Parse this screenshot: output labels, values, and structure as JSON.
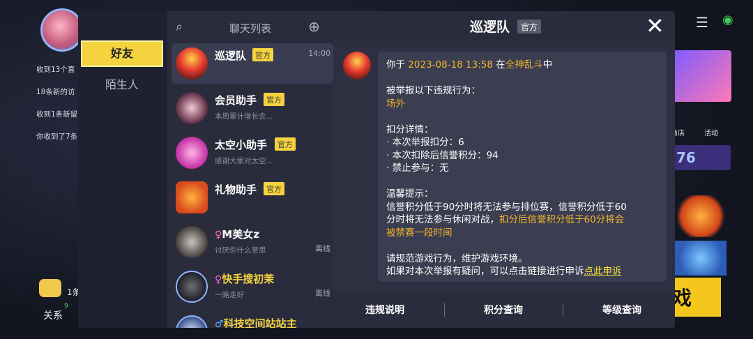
{
  "background": {
    "notifications": [
      "收到13个喜",
      "18条新的访",
      "收到1条新留",
      "你收到了7条"
    ],
    "relations_label": "关系",
    "relations_count": "9",
    "relations_extra": "1条",
    "store_label": "商店",
    "activity_label": "活动",
    "score_text": "76",
    "game_text": "戏",
    "menu_icon": "menu-icon",
    "signal_icon": "signal-icon"
  },
  "tabs": {
    "friends": "好友",
    "strangers": "陌生人"
  },
  "list": {
    "title": "聊天列表",
    "items": [
      {
        "name": "巡逻队",
        "badge": "官方",
        "preview": "",
        "time": "14:00",
        "status": ""
      },
      {
        "name": "会员助手",
        "badge": "官方",
        "preview": "本周累计增长会...",
        "time": "",
        "status": ""
      },
      {
        "name": "太空小助手",
        "badge": "官方",
        "preview": "感谢大家对太空...",
        "time": "",
        "status": ""
      },
      {
        "name": "礼物助手",
        "badge": "官方",
        "preview": "",
        "time": "",
        "status": ""
      },
      {
        "name": "M美女z",
        "badge": "",
        "preview": "讨厌你什么意思",
        "time": "",
        "status": "离线",
        "gender": "♀"
      },
      {
        "name": "快手搜初茉",
        "badge": "",
        "preview": "一路走好",
        "time": "",
        "status": "离线",
        "gender": "♀"
      },
      {
        "name": "科技空间站站主",
        "badge": "",
        "preview": "",
        "time": "",
        "status": "",
        "gender": "♂"
      }
    ]
  },
  "chat": {
    "title": "巡逻队",
    "badge": "官方",
    "message": {
      "l1_pre": "你于 ",
      "l1_date": "2023-08-18 13:58",
      "l1_mid": " 在",
      "l1_mode": "全神乱斗",
      "l1_post": "中",
      "l2": "被举报以下违规行为：",
      "l3": "场外",
      "l4": "扣分详情：",
      "l5": "· 本次举报扣分：6",
      "l6": "· 本次扣除后信誉积分：94",
      "l7": "· 禁止参与：无",
      "l8": "温馨提示：",
      "l9": "信誉积分低于90分时将无法参与排位赛，信誉积分低于60",
      "l10_pre": "分时将无法参与休闲对战，",
      "l10_hl": "扣分后信誉积分低于60分将会",
      "l11": "被禁赛一段时间",
      "l12": "请规范游戏行为，维护游戏环境。",
      "l13_pre": "如果对本次举报有疑问，可以点击链接进行申诉",
      "l13_link": "点此申诉"
    },
    "footer": {
      "rules": "违规说明",
      "points": "积分查询",
      "level": "等级查询"
    }
  },
  "colors": {
    "accent": "#f5d33f",
    "highlight": "#f5b62e",
    "link": "#f5e43a"
  }
}
